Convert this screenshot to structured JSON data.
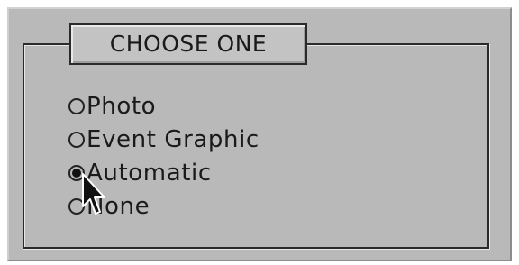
{
  "group": {
    "title": "CHOOSE ONE"
  },
  "options": [
    {
      "label": "Photo",
      "checked": false
    },
    {
      "label": "Event Graphic",
      "checked": false
    },
    {
      "label": "Automatic",
      "checked": true
    },
    {
      "label": "None",
      "checked": false
    }
  ],
  "icons": {
    "cursor": "mouse-pointer-icon"
  },
  "colors": {
    "panel_background": "#b9b9b9",
    "title_background": "#c3c3c3",
    "text": "#1a1a1a"
  }
}
